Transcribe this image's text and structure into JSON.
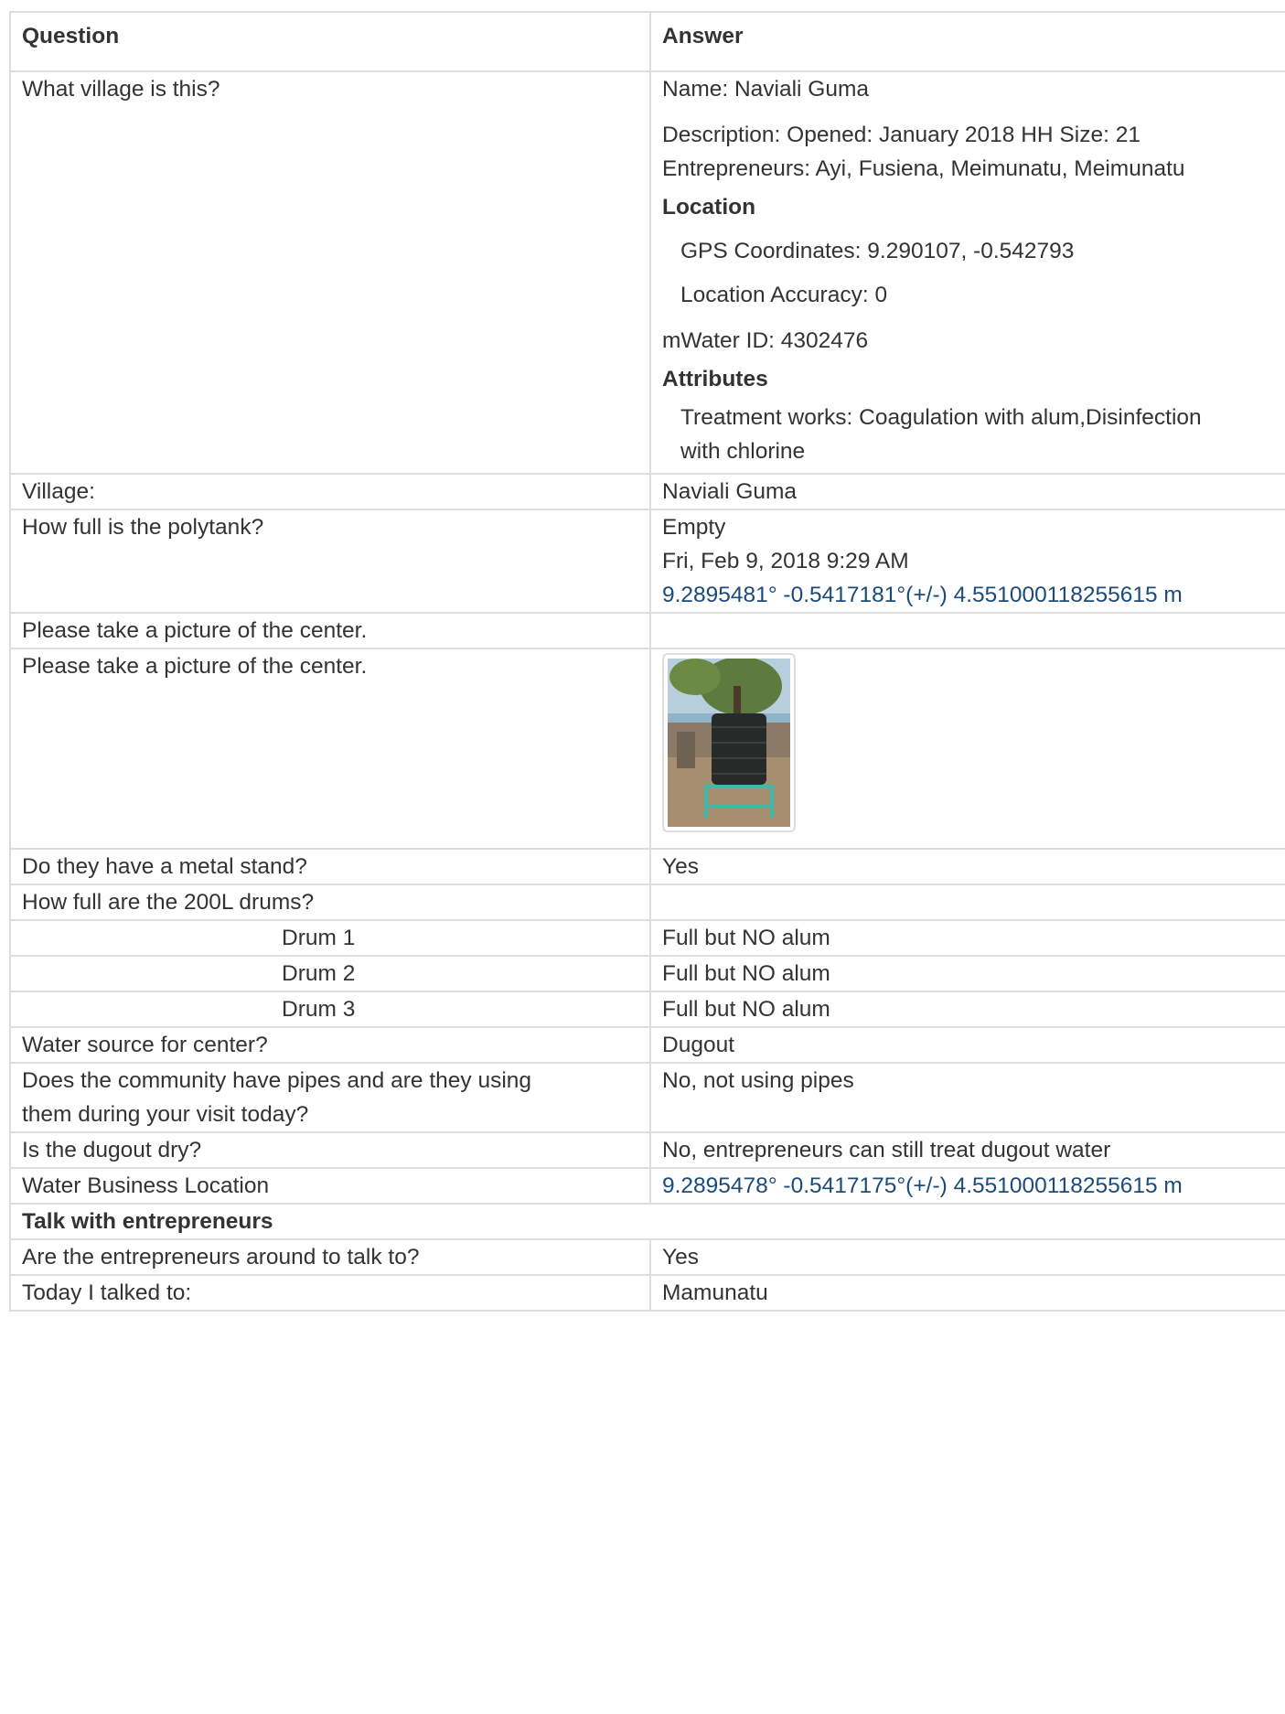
{
  "header": {
    "question": "Question",
    "answer": "Answer"
  },
  "village_q": "What village is this?",
  "site": {
    "name_line": "Name: Naviali Guma",
    "desc_line1": "Description: Opened: January 2018 HH Size: 21",
    "desc_line2": "Entrepreneurs: Ayi, Fusiena, Meimunatu, Meimunatu",
    "location_heading": "Location",
    "gps": "GPS Coordinates: 9.290107, -0.542793",
    "accuracy": "Location Accuracy: 0",
    "mwater_id": "mWater ID: 4302476",
    "attributes_heading": "Attributes",
    "treatment_line1": "Treatment works: Coagulation with alum,Disinfection",
    "treatment_line2": "with chlorine"
  },
  "rows": {
    "village": {
      "q": "Village:",
      "a": "Naviali Guma"
    },
    "polytank": {
      "q": "How full is the polytank?",
      "a": "Empty",
      "timestamp": "Fri, Feb 9, 2018 9:29 AM",
      "coords": "9.2895481° -0.5417181°(+/-) 4.551000118255615 m"
    },
    "picture1": {
      "q": "Please take a picture of the center.",
      "a": ""
    },
    "picture2": {
      "q": "Please take a picture of the center."
    },
    "metal_stand": {
      "q": "Do they have a metal stand?",
      "a": "Yes"
    },
    "drums_header": {
      "q": "How full are the 200L drums?",
      "a": ""
    },
    "drum1": {
      "q": "Drum 1",
      "a": "Full but NO alum"
    },
    "drum2": {
      "q": "Drum 2",
      "a": "Full but NO alum"
    },
    "drum3": {
      "q": "Drum 3",
      "a": "Full but NO alum"
    },
    "water_source": {
      "q": "Water source for center?",
      "a": "Dugout"
    },
    "pipes": {
      "q1": "Does the community have pipes and are they using",
      "q2": "them during your visit today?",
      "a": "No, not using pipes"
    },
    "dugout_dry": {
      "q": "Is the dugout dry?",
      "a": "No, entrepreneurs can still treat dugout water"
    },
    "business_location": {
      "q": "Water Business Location",
      "a": "9.2895478° -0.5417175°(+/-) 4.551000118255615 m"
    },
    "section_talk": "Talk with entrepreneurs",
    "around": {
      "q": "Are the entrepreneurs around to talk to?",
      "a": "Yes"
    },
    "talked_to": {
      "q": "Today I talked to:",
      "a": "Mamunatu"
    }
  },
  "colors": {
    "border": "#dddddd",
    "text": "#333333",
    "link": "#1b4b7a"
  },
  "icons": {
    "photo": "polytank-photo-thumbnail"
  }
}
